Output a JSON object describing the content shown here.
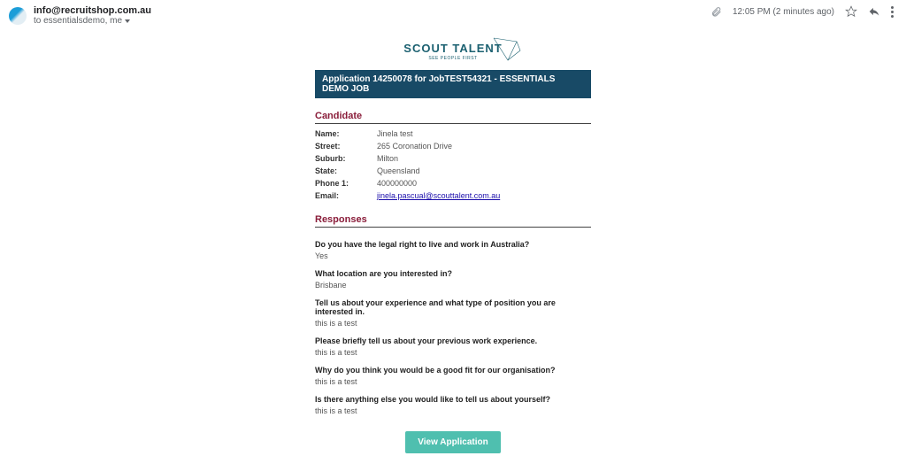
{
  "header": {
    "from": "info@recruitshop.com.au",
    "to_line": "to essentialsdemo, me",
    "timestamp": "12:05 PM (2 minutes ago)"
  },
  "logo": {
    "main": "SCOUT TALENT",
    "sub": "SEE PEOPLE FIRST"
  },
  "banner": "Application 14250078 for JobTEST54321 - ESSENTIALS DEMO JOB",
  "sections": {
    "candidate_title": "Candidate",
    "responses_title": "Responses"
  },
  "candidate": [
    {
      "label": "Name:",
      "value": "Jinela test"
    },
    {
      "label": "Street:",
      "value": "265 Coronation Drive"
    },
    {
      "label": "Suburb:",
      "value": "Milton"
    },
    {
      "label": "State:",
      "value": "Queensland"
    },
    {
      "label": "Phone 1:",
      "value": "400000000"
    },
    {
      "label": "Email:",
      "value": "jinela.pascual@scouttalent.com.au",
      "is_link": true
    }
  ],
  "responses": [
    {
      "q": "Do you have the legal right to live and work in Australia?",
      "a": "Yes"
    },
    {
      "q": "What location are you interested in?",
      "a": "Brisbane"
    },
    {
      "q": "Tell us about your experience and what type of position you are interested in.",
      "a": "this is a test"
    },
    {
      "q": "Please briefly tell us about your previous work experience.",
      "a": "this is a test"
    },
    {
      "q": "Why do you think you would be a good fit for our organisation?",
      "a": "this is a test"
    },
    {
      "q": "Is there anything else you would like to tell us about yourself?",
      "a": "this is a test"
    }
  ],
  "button_label": "View Application"
}
